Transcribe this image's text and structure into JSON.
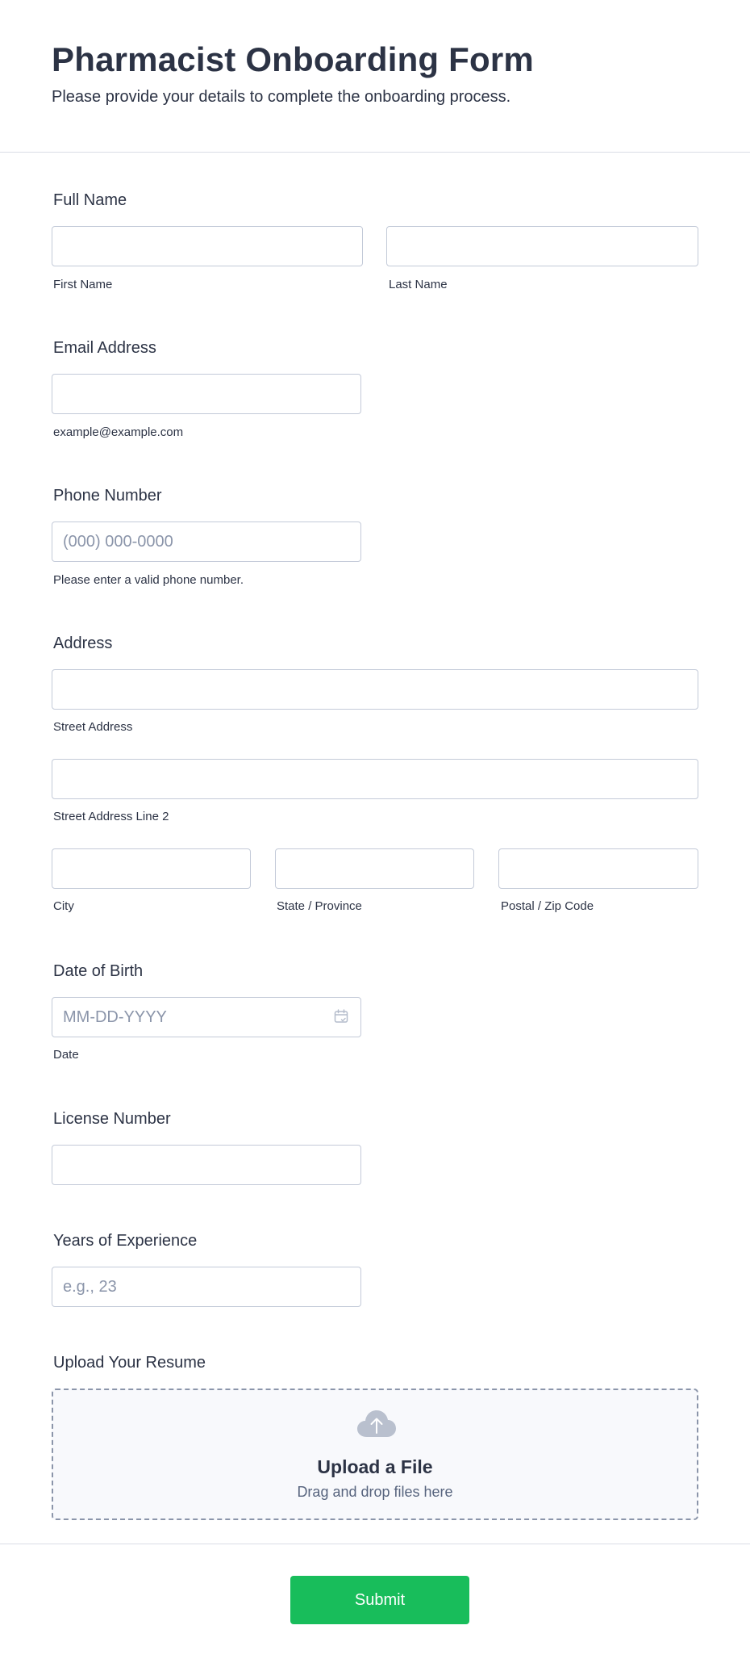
{
  "header": {
    "title": "Pharmacist Onboarding Form",
    "subtitle": "Please provide your details to complete the onboarding process."
  },
  "full_name": {
    "label": "Full Name",
    "first_sublabel": "First Name",
    "last_sublabel": "Last Name",
    "first_value": "",
    "last_value": ""
  },
  "email": {
    "label": "Email Address",
    "sublabel": "example@example.com",
    "value": ""
  },
  "phone": {
    "label": "Phone Number",
    "placeholder": "(000) 000-0000",
    "sublabel": "Please enter a valid phone number.",
    "value": ""
  },
  "address": {
    "label": "Address",
    "street_sublabel": "Street Address",
    "street2_sublabel": "Street Address Line 2",
    "city_sublabel": "City",
    "state_sublabel": "State / Province",
    "zip_sublabel": "Postal / Zip Code"
  },
  "dob": {
    "label": "Date of Birth",
    "placeholder": "MM-DD-YYYY",
    "sublabel": "Date",
    "icon": "calendar-icon"
  },
  "license": {
    "label": "License Number",
    "value": ""
  },
  "experience": {
    "label": "Years of Experience",
    "placeholder": "e.g., 23"
  },
  "resume": {
    "label": "Upload Your Resume",
    "upload_title": "Upload a File",
    "upload_hint": "Drag and drop files here",
    "icon": "cloud-upload-icon"
  },
  "submit": {
    "label": "Submit",
    "color": "#18bd5b"
  },
  "colors": {
    "text": "#2c3345",
    "border": "#c3cad8",
    "placeholder": "#8b95aa",
    "upload_bg": "#f8f9fc"
  }
}
